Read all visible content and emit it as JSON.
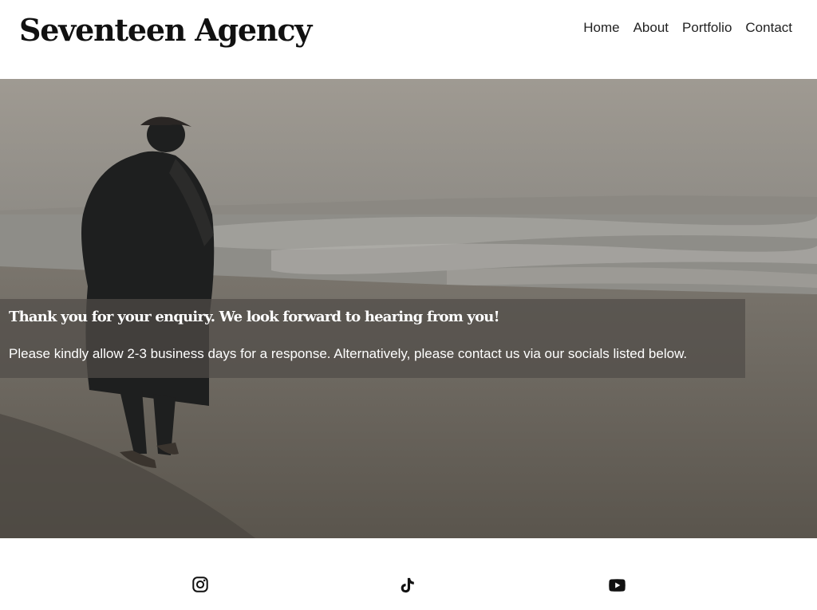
{
  "site": {
    "title": "Seventeen Agency"
  },
  "nav": {
    "items": [
      {
        "label": "Home"
      },
      {
        "label": "About"
      },
      {
        "label": "Portfolio"
      },
      {
        "label": "Contact"
      }
    ]
  },
  "hero": {
    "image": "man-walking-on-stormy-beach-photo",
    "heading": "Thank you for your enquiry. We look forward to hearing from you!",
    "text": "Please kindly allow 2-3 business days for a response. Alternatively, please contact us via our socials listed below."
  },
  "socials": {
    "items": [
      {
        "icon": "instagram-icon"
      },
      {
        "icon": "tiktok-icon"
      },
      {
        "icon": "youtube-icon"
      }
    ]
  },
  "colors": {
    "text": "#111111",
    "overlay": "#504c48"
  }
}
